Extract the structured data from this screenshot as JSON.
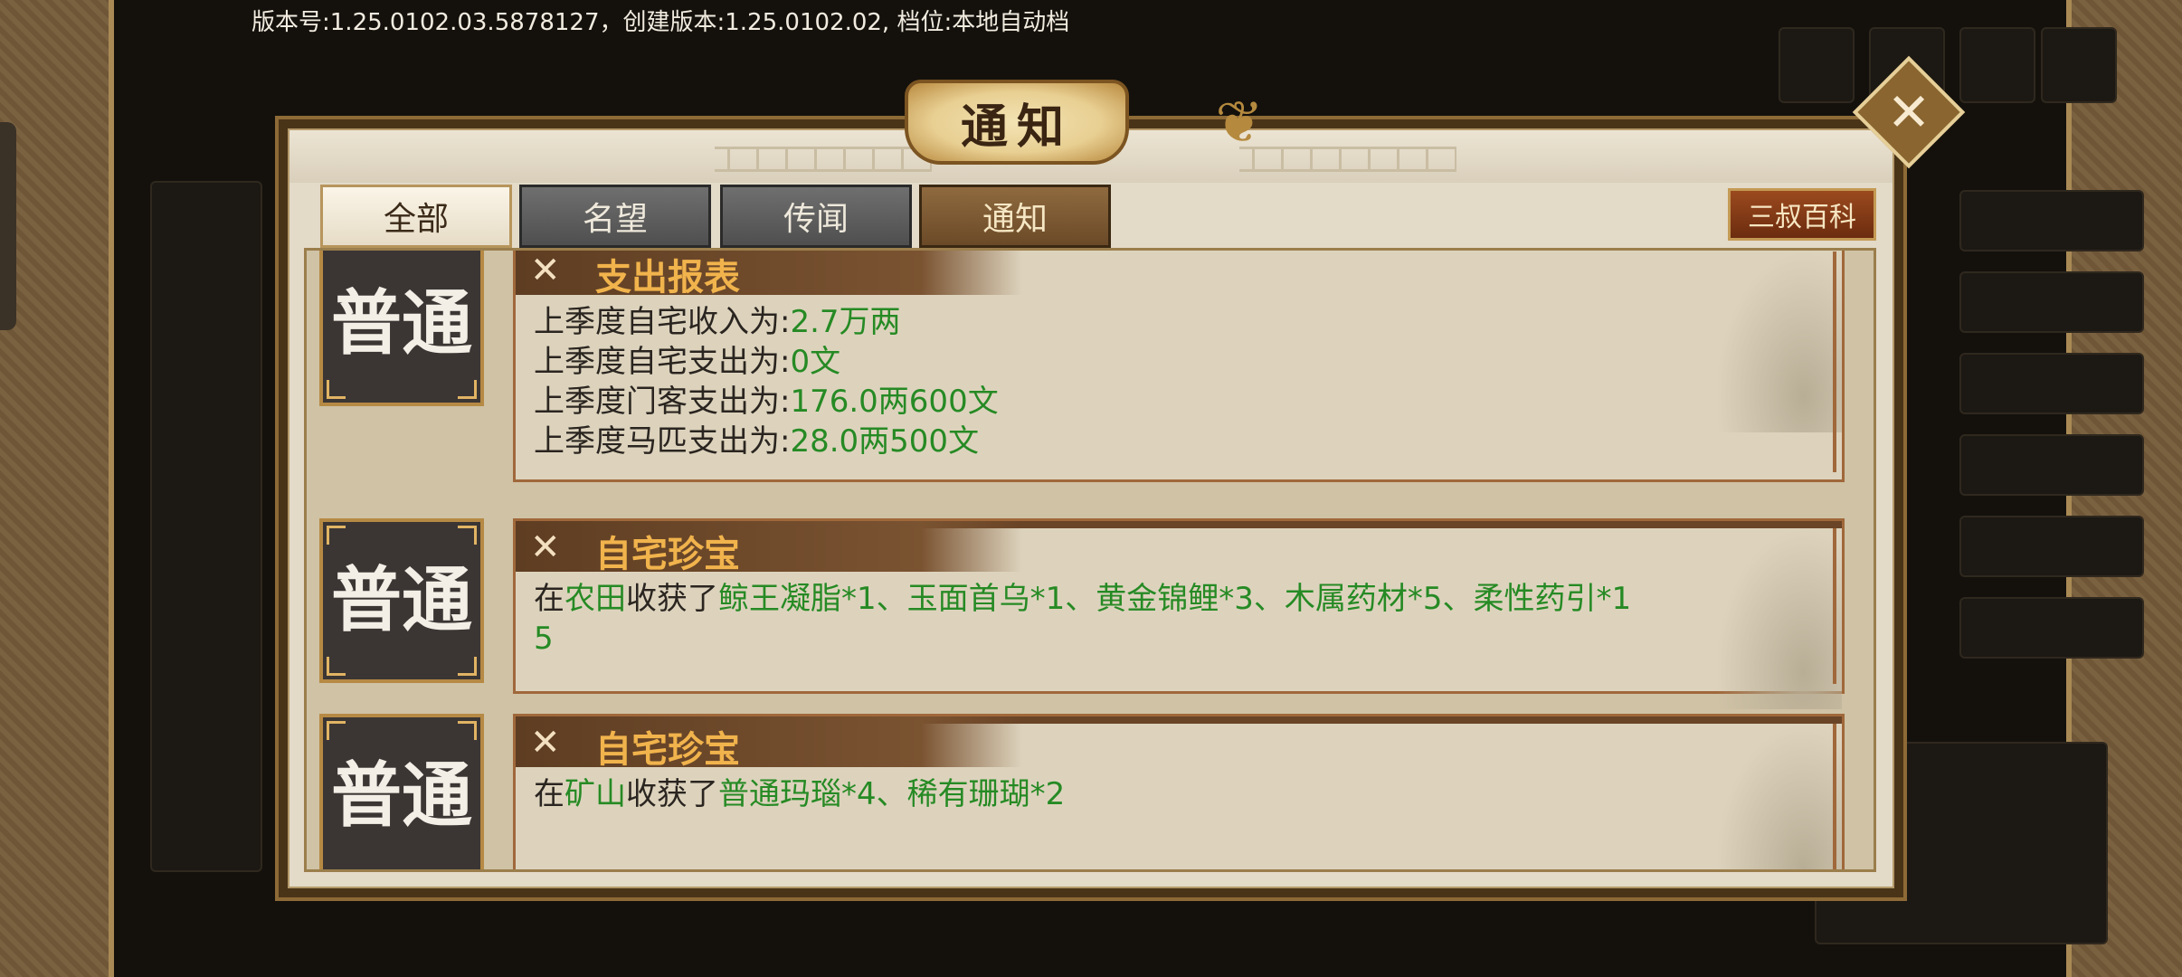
{
  "version_info": "版本号:1.25.0102.03.5878127，创建版本:1.25.0102.02, 档位:本地自动档",
  "dialog": {
    "title": "通知",
    "wiki_button": "三叔百科",
    "tabs": [
      {
        "label": "全部",
        "active": true
      },
      {
        "label": "名望",
        "active": false
      },
      {
        "label": "传闻",
        "active": false
      },
      {
        "label": "通知",
        "active": false
      }
    ]
  },
  "messages": [
    {
      "badge": "普通",
      "title": "支出报表",
      "lines": [
        {
          "label": "上季度自宅收入为:",
          "value": "2.7万两"
        },
        {
          "label": "上季度自宅支出为:",
          "value": "0文"
        },
        {
          "label": "上季度门客支出为:",
          "value": "176.0两600文"
        },
        {
          "label": "上季度马匹支出为:",
          "value": "28.0两500文"
        }
      ]
    },
    {
      "badge": "普通",
      "title": "自宅珍宝",
      "prefix": "在",
      "place": "农田",
      "verb": "收获了",
      "items_line1": "鲸王凝脂*1、玉面首乌*1、黄金锦鲤*3、木属药材*5、柔性药引*1",
      "items_line2": "5"
    },
    {
      "badge": "普通",
      "title": "自宅珍宝",
      "prefix": "在",
      "place": "矿山",
      "verb": "收获了",
      "items_line1": "普通玛瑙*4、稀有珊瑚*2"
    }
  ],
  "colors": {
    "highlight_green": "#268a24",
    "title_orange": "#f1b34c",
    "dialog_frame": "#4a3418"
  }
}
